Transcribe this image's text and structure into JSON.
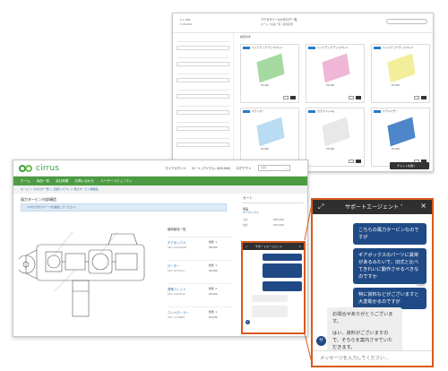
{
  "background_window": {
    "title": "アクセサリー&カタログ一覧",
    "breadcrumb": "ホーム / 商品一覧 / 検索結果",
    "account_lines": [
      "¥ 1,000",
      "¥ 24,000"
    ],
    "filter_label": "検索条件",
    "chat_button": "チャットを開く",
    "cards": [
      {
        "title": "ヘッドアップ ディスプレイ",
        "color": "#a6d9a0",
        "price": "¥3,000"
      },
      {
        "title": "ヘッドアップ ディスプレイ",
        "color": "#f0b6d6",
        "price": "¥3,000"
      },
      {
        "title": "ヘッドアップ ディスプレイ",
        "color": "#f3ee9a",
        "price": "¥3,000"
      },
      {
        "title": "ステッカー",
        "color": "#b9dcf2",
        "price": "¥3,000"
      },
      {
        "title": "ガラスフィルム",
        "color": "#e8e8e8",
        "price": "¥3,000"
      },
      {
        "title": "ドアバイザー",
        "color": "#4d86c9",
        "price": "¥3,000"
      }
    ]
  },
  "main_window": {
    "logo": "cirrus",
    "header_links": [
      "マイアカウント",
      "カート (アイテム: ¥33,000)",
      "ログアウト"
    ],
    "search_placeholder": "検索",
    "nav_items": [
      "ホーム",
      "商品一覧",
      "会社概要",
      "お問い合わせ",
      "ユーザーコミュニティ"
    ],
    "breadcrumb": "ホーム ＞ カタログ一覧 ＞ 空調システム ＞ 風力タービン用部品",
    "page_title": "風力タービン内部構造",
    "alert": "カタログからパーツを追加してください。",
    "parts_heading": "使用部品一覧",
    "parts": [
      {
        "name": "ギアボックス",
        "sku": "SKU: GR-00020",
        "qty": "数量: 1",
        "price": "¥8,000"
      },
      {
        "name": "ローター",
        "sku": "SKU: RT-0014",
        "qty": "数量: 1",
        "price": "¥4,000"
      },
      {
        "name": "発電ユニット",
        "sku": "SKU: GN-0012",
        "qty": "数量: 2",
        "price": "¥4,000"
      },
      {
        "name": "コントローラー",
        "sku": "SKU: CT-0009",
        "qty": "数量: 1",
        "price": "¥4,000"
      }
    ],
    "cart_heading": "カート",
    "cart_label": "製品",
    "cart_value": "ギアボックス",
    "cart_grid": [
      "小計",
      "¥28,000",
      "合計",
      "¥33,000"
    ]
  },
  "mini_chat": {
    "title": "サポートエージェント",
    "avatar": "サ"
  },
  "chat": {
    "title": "サポートエージェント",
    "messages": [
      {
        "side": "right",
        "text": "こちらの風力タービンなのですが"
      },
      {
        "side": "right",
        "text": "ギアボックスのパーツに異常があるみたいで、旧式と比べてきれいに動作させるべきなのですか"
      },
      {
        "side": "right",
        "text": "特に資料などがございますと大変助かるのですが"
      },
      {
        "side": "left",
        "text": "お問合せありがとうございます。"
      },
      {
        "side": "left",
        "text": "はい、資料がございますので、そちらを案内させていただきます。"
      }
    ],
    "timestamp": "(既読)",
    "avatar": "サ",
    "agent_label": "サポートエージェント",
    "input_placeholder": "メッセージを入力してください..."
  },
  "colors": {
    "accent_orange": "#d85a1c",
    "nav_green": "#4d9c43",
    "bubble_blue": "#1f4a86",
    "header_dark": "#2f2f2f"
  }
}
